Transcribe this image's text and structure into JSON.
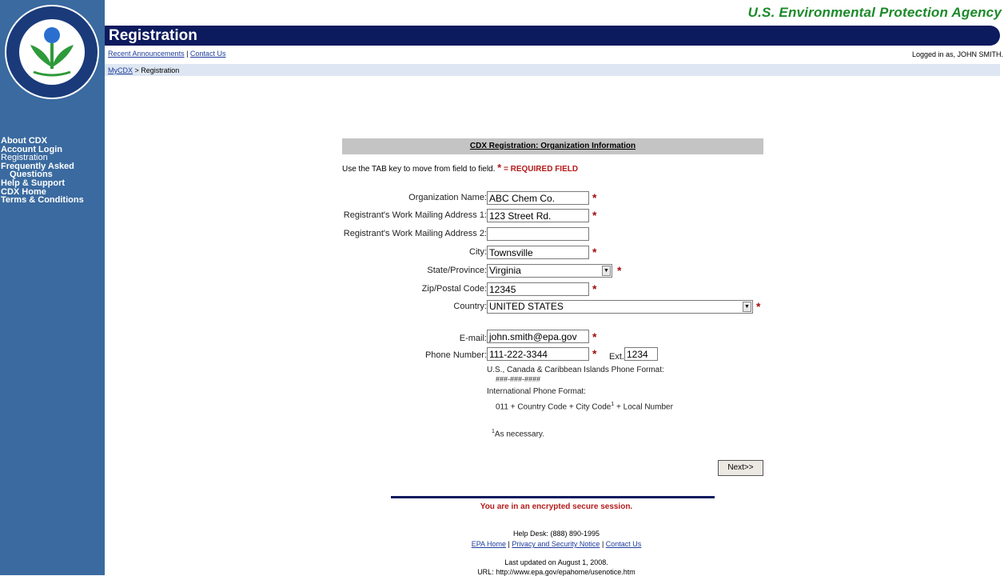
{
  "agency": "U.S. Environmental Protection Agency",
  "banner_title": "Registration",
  "toplinks": {
    "announcements": "Recent Announcements",
    "sep": " | ",
    "contact": "Contact Us"
  },
  "logged_in": "Logged in as, JOHN SMITH.",
  "breadcrumb": {
    "home": "MyCDX",
    "sep": " > ",
    "current": "Registration"
  },
  "sidebar": {
    "items": [
      {
        "label": "About CDX"
      },
      {
        "label": "Account Login"
      },
      {
        "label": "Registration"
      },
      {
        "label": "Frequently Asked"
      },
      {
        "label": "Questions"
      },
      {
        "label": "Help & Support"
      },
      {
        "label": "CDX Home"
      },
      {
        "label": "Terms & Conditions"
      }
    ]
  },
  "form": {
    "header": "CDX Registration: Organization Information",
    "instructions": "Use the TAB key to move from field to field.",
    "required_legend": "= REQUIRED FIELD",
    "star": "*",
    "fields": {
      "org_name": {
        "label": "Organization Name:",
        "value": "ABC Chem Co."
      },
      "address1": {
        "label": "Registrant's Work Mailing Address 1:",
        "value": "123 Street Rd."
      },
      "address2": {
        "label": "Registrant's Work Mailing Address 2:",
        "value": ""
      },
      "city": {
        "label": "City:",
        "value": "Townsville"
      },
      "state": {
        "label": "State/Province:",
        "value": "Virginia"
      },
      "zip": {
        "label": "Zip/Postal Code:",
        "value": "12345"
      },
      "country": {
        "label": "Country:",
        "value": "UNITED STATES"
      },
      "email": {
        "label": "E-mail:",
        "value": "john.smith@epa.gov"
      },
      "phone": {
        "label": "Phone Number:",
        "value": "111-222-3344"
      },
      "ext": {
        "label": "Ext.",
        "value": "1234"
      }
    },
    "phone_notes": {
      "us_format_label": "U.S., Canada & Caribbean Islands Phone Format:",
      "us_format": "###-###-####",
      "intl_label": "International Phone Format:",
      "intl_format_a": "011 + Country Code + City Code",
      "intl_sup": "1",
      "intl_format_b": " + Local Number",
      "footnote_sup": "1",
      "footnote": "As necessary."
    },
    "next_button": "Next>>"
  },
  "secure_notice": "You are in an encrypted secure session.",
  "footer": {
    "helpdesk": "Help Desk: (888) 890-1995",
    "links": [
      "EPA Home",
      "Privacy and Security Notice",
      "Contact Us"
    ],
    "sep": " | ",
    "updated": "Last updated on August 1, 2008.",
    "url": "URL: http://www.epa.gov/epahome/usenotice.htm"
  },
  "colors": {
    "sidebar": "#3a6a9f",
    "banner": "#0c1a5e",
    "agency": "#1c8a2a",
    "required": "#b31b1b"
  }
}
